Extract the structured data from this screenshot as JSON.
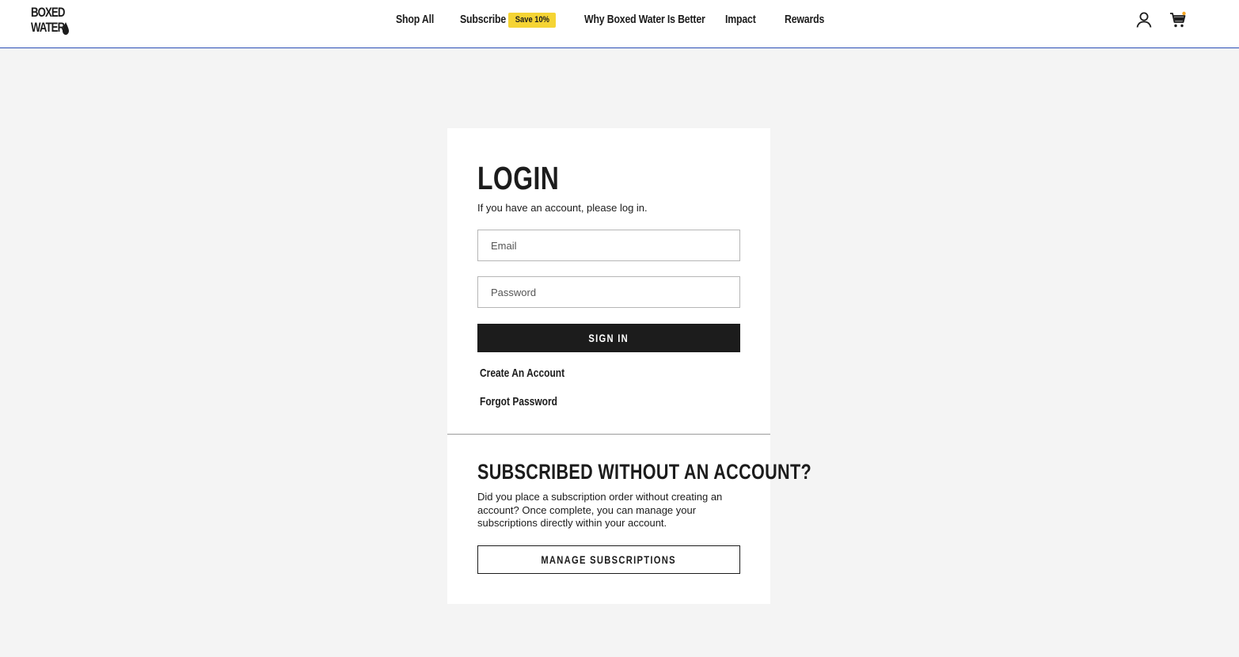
{
  "header": {
    "logo": {
      "line1": "BOXED",
      "line2": "WATER"
    },
    "nav": {
      "shop_all": "Shop All",
      "subscribe": "Subscribe",
      "subscribe_badge": "Save 10%",
      "why": "Why Boxed Water Is Better",
      "impact": "Impact",
      "rewards": "Rewards"
    },
    "icons": {
      "account": "user-icon",
      "cart": "cart-icon"
    }
  },
  "login": {
    "title": "LOGIN",
    "subtitle": "If you have an account, please log in.",
    "email_placeholder": "Email",
    "email_value": "",
    "password_placeholder": "Password",
    "password_value": "",
    "sign_in_label": "SIGN IN",
    "create_account": "Create An Account",
    "forgot_password": "Forgot Password"
  },
  "subscribed": {
    "title": "SUBSCRIBED WITHOUT AN ACCOUNT?",
    "text": "Did you place a subscription order without creating an account? Once complete, you can manage your subscriptions directly within your account.",
    "button_label": "MANAGE SUBSCRIPTIONS"
  },
  "colors": {
    "accent_badge": "#f5d434",
    "header_border": "#2b4fb6",
    "page_background": "#f4f4f4",
    "primary_dark": "#1c1c1c",
    "cart_dot": "#f5a623"
  }
}
